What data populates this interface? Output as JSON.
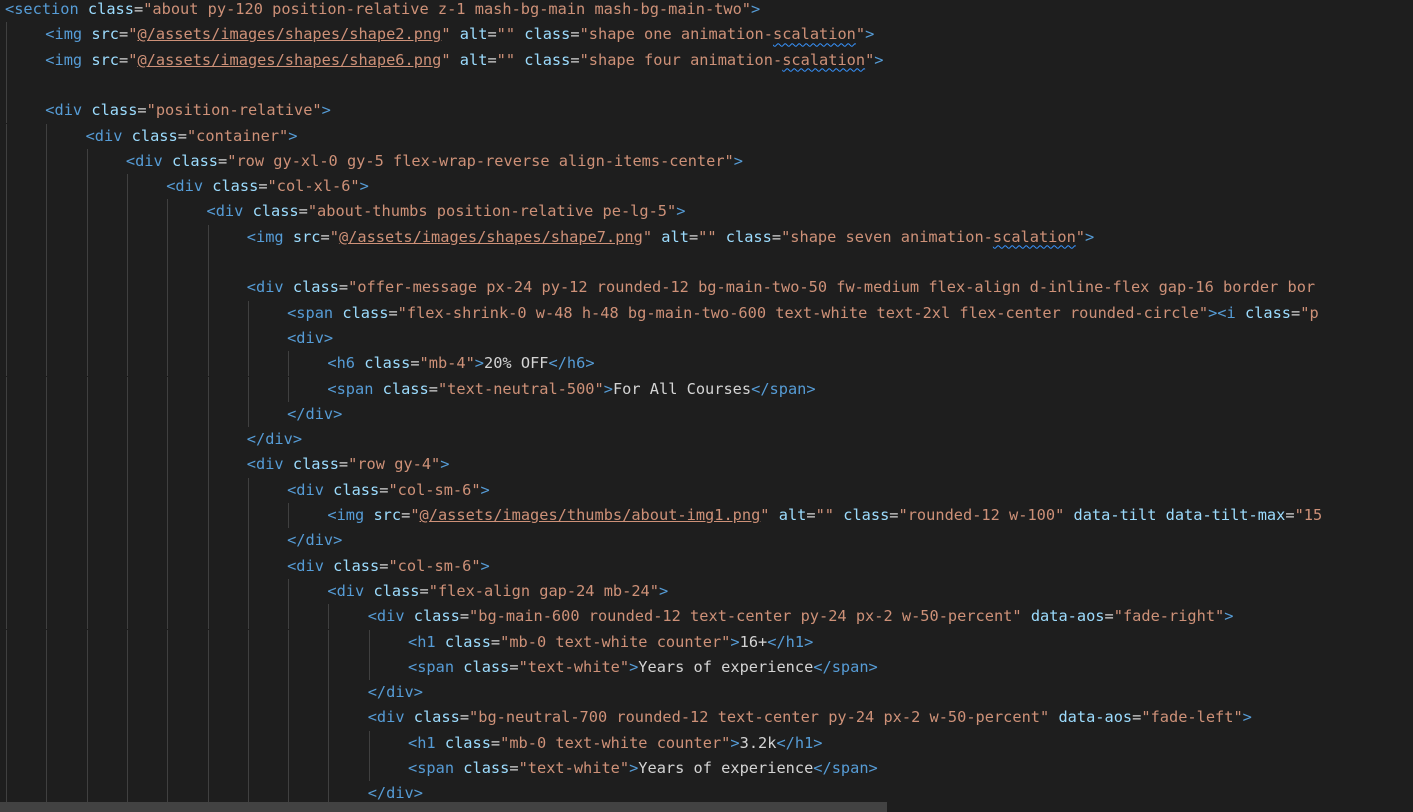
{
  "editor": {
    "lines": [
      {
        "indent": 0,
        "tokens": [
          [
            "tag",
            "<section"
          ],
          [
            "txt",
            " "
          ],
          [
            "attr",
            "class"
          ],
          [
            "txt",
            "="
          ],
          [
            "val",
            "\"about py-120 position-relative z-1 mash-bg-main mash-bg-main-two\""
          ],
          [
            "tag",
            ">"
          ]
        ]
      },
      {
        "indent": 1,
        "tokens": [
          [
            "tag",
            "<img"
          ],
          [
            "txt",
            " "
          ],
          [
            "attr",
            "src"
          ],
          [
            "txt",
            "="
          ],
          [
            "val",
            "\""
          ],
          [
            "val url",
            "@/assets/images/shapes/shape2.png"
          ],
          [
            "val",
            "\""
          ],
          [
            "txt",
            " "
          ],
          [
            "attr",
            "alt"
          ],
          [
            "txt",
            "="
          ],
          [
            "val",
            "\"\""
          ],
          [
            "txt",
            " "
          ],
          [
            "attr",
            "class"
          ],
          [
            "txt",
            "="
          ],
          [
            "val",
            "\"shape one animation-"
          ],
          [
            "val squiggle",
            "scalation"
          ],
          [
            "val",
            "\""
          ],
          [
            "tag",
            ">"
          ]
        ]
      },
      {
        "indent": 1,
        "tokens": [
          [
            "tag",
            "<img"
          ],
          [
            "txt",
            " "
          ],
          [
            "attr",
            "src"
          ],
          [
            "txt",
            "="
          ],
          [
            "val",
            "\""
          ],
          [
            "val url",
            "@/assets/images/shapes/shape6.png"
          ],
          [
            "val",
            "\""
          ],
          [
            "txt",
            " "
          ],
          [
            "attr",
            "alt"
          ],
          [
            "txt",
            "="
          ],
          [
            "val",
            "\"\""
          ],
          [
            "txt",
            " "
          ],
          [
            "attr",
            "class"
          ],
          [
            "txt",
            "="
          ],
          [
            "val",
            "\"shape four animation-"
          ],
          [
            "val squiggle",
            "scalation"
          ],
          [
            "val",
            "\""
          ],
          [
            "tag",
            ">"
          ]
        ]
      },
      {
        "indent": 0,
        "tokens": []
      },
      {
        "indent": 1,
        "tokens": [
          [
            "tag",
            "<div"
          ],
          [
            "txt",
            " "
          ],
          [
            "attr",
            "class"
          ],
          [
            "txt",
            "="
          ],
          [
            "val",
            "\"position-relative\""
          ],
          [
            "tag",
            ">"
          ]
        ]
      },
      {
        "indent": 2,
        "tokens": [
          [
            "tag",
            "<div"
          ],
          [
            "txt",
            " "
          ],
          [
            "attr",
            "class"
          ],
          [
            "txt",
            "="
          ],
          [
            "val",
            "\"container\""
          ],
          [
            "tag",
            ">"
          ]
        ]
      },
      {
        "indent": 3,
        "tokens": [
          [
            "tag",
            "<div"
          ],
          [
            "txt",
            " "
          ],
          [
            "attr",
            "class"
          ],
          [
            "txt",
            "="
          ],
          [
            "val",
            "\"row gy-xl-0 gy-5 flex-wrap-reverse align-items-center\""
          ],
          [
            "tag",
            ">"
          ]
        ]
      },
      {
        "indent": 4,
        "tokens": [
          [
            "tag",
            "<div"
          ],
          [
            "txt",
            " "
          ],
          [
            "attr",
            "class"
          ],
          [
            "txt",
            "="
          ],
          [
            "val",
            "\"col-xl-6\""
          ],
          [
            "tag",
            ">"
          ]
        ]
      },
      {
        "indent": 5,
        "tokens": [
          [
            "tag",
            "<div"
          ],
          [
            "txt",
            " "
          ],
          [
            "attr",
            "class"
          ],
          [
            "txt",
            "="
          ],
          [
            "val",
            "\"about-thumbs position-relative pe-lg-5\""
          ],
          [
            "tag",
            ">"
          ]
        ]
      },
      {
        "indent": 6,
        "tokens": [
          [
            "tag",
            "<img"
          ],
          [
            "txt",
            " "
          ],
          [
            "attr",
            "src"
          ],
          [
            "txt",
            "="
          ],
          [
            "val",
            "\""
          ],
          [
            "val url",
            "@/assets/images/shapes/shape7.png"
          ],
          [
            "val",
            "\""
          ],
          [
            "txt",
            " "
          ],
          [
            "attr",
            "alt"
          ],
          [
            "txt",
            "="
          ],
          [
            "val",
            "\"\""
          ],
          [
            "txt",
            " "
          ],
          [
            "attr",
            "class"
          ],
          [
            "txt",
            "="
          ],
          [
            "val",
            "\"shape seven animation-"
          ],
          [
            "val squiggle",
            "scalation"
          ],
          [
            "val",
            "\""
          ],
          [
            "tag",
            ">"
          ]
        ]
      },
      {
        "indent": 0,
        "tokens": []
      },
      {
        "indent": 6,
        "tokens": [
          [
            "tag",
            "<div"
          ],
          [
            "txt",
            " "
          ],
          [
            "attr",
            "class"
          ],
          [
            "txt",
            "="
          ],
          [
            "val",
            "\"offer-message px-24 py-12 rounded-12 bg-main-two-50 fw-medium flex-align d-inline-flex gap-16 border bor"
          ]
        ]
      },
      {
        "indent": 7,
        "tokens": [
          [
            "tag",
            "<span"
          ],
          [
            "txt",
            " "
          ],
          [
            "attr",
            "class"
          ],
          [
            "txt",
            "="
          ],
          [
            "val",
            "\"flex-shrink-0 w-48 h-48 bg-main-two-600 text-white text-2xl flex-center rounded-circle\""
          ],
          [
            "tag",
            "><i"
          ],
          [
            "txt",
            " "
          ],
          [
            "attr",
            "class"
          ],
          [
            "txt",
            "="
          ],
          [
            "val",
            "\"p"
          ]
        ]
      },
      {
        "indent": 7,
        "tokens": [
          [
            "tag",
            "<div>"
          ]
        ]
      },
      {
        "indent": 8,
        "tokens": [
          [
            "tag",
            "<h6"
          ],
          [
            "txt",
            " "
          ],
          [
            "attr",
            "class"
          ],
          [
            "txt",
            "="
          ],
          [
            "val",
            "\"mb-4\""
          ],
          [
            "tag",
            ">"
          ],
          [
            "txt",
            "20% OFF"
          ],
          [
            "tag",
            "</h6>"
          ]
        ]
      },
      {
        "indent": 8,
        "tokens": [
          [
            "tag",
            "<span"
          ],
          [
            "txt",
            " "
          ],
          [
            "attr",
            "class"
          ],
          [
            "txt",
            "="
          ],
          [
            "val",
            "\"text-neutral-500\""
          ],
          [
            "tag",
            ">"
          ],
          [
            "txt",
            "For All Courses"
          ],
          [
            "tag",
            "</span>"
          ]
        ]
      },
      {
        "indent": 7,
        "tokens": [
          [
            "tag",
            "</div>"
          ]
        ]
      },
      {
        "indent": 6,
        "tokens": [
          [
            "tag",
            "</div>"
          ]
        ]
      },
      {
        "indent": 6,
        "tokens": [
          [
            "tag",
            "<div"
          ],
          [
            "txt",
            " "
          ],
          [
            "attr",
            "class"
          ],
          [
            "txt",
            "="
          ],
          [
            "val",
            "\"row gy-4\""
          ],
          [
            "tag",
            ">"
          ]
        ]
      },
      {
        "indent": 7,
        "tokens": [
          [
            "tag",
            "<div"
          ],
          [
            "txt",
            " "
          ],
          [
            "attr",
            "class"
          ],
          [
            "txt",
            "="
          ],
          [
            "val",
            "\"col-sm-6\""
          ],
          [
            "tag",
            ">"
          ]
        ]
      },
      {
        "indent": 8,
        "tokens": [
          [
            "tag",
            "<img"
          ],
          [
            "txt",
            " "
          ],
          [
            "attr",
            "src"
          ],
          [
            "txt",
            "="
          ],
          [
            "val",
            "\""
          ],
          [
            "val url",
            "@/assets/images/thumbs/about-img1.png"
          ],
          [
            "val",
            "\""
          ],
          [
            "txt",
            " "
          ],
          [
            "attr",
            "alt"
          ],
          [
            "txt",
            "="
          ],
          [
            "val",
            "\"\""
          ],
          [
            "txt",
            " "
          ],
          [
            "attr",
            "class"
          ],
          [
            "txt",
            "="
          ],
          [
            "val",
            "\"rounded-12 w-100\""
          ],
          [
            "txt",
            " "
          ],
          [
            "attr",
            "data-tilt"
          ],
          [
            "txt",
            " "
          ],
          [
            "attr",
            "data-tilt-max"
          ],
          [
            "txt",
            "="
          ],
          [
            "val",
            "\"15"
          ]
        ]
      },
      {
        "indent": 7,
        "tokens": [
          [
            "tag",
            "</div>"
          ]
        ]
      },
      {
        "indent": 7,
        "tokens": [
          [
            "tag",
            "<div"
          ],
          [
            "txt",
            " "
          ],
          [
            "attr",
            "class"
          ],
          [
            "txt",
            "="
          ],
          [
            "val",
            "\"col-sm-6\""
          ],
          [
            "tag",
            ">"
          ]
        ]
      },
      {
        "indent": 8,
        "tokens": [
          [
            "tag",
            "<div"
          ],
          [
            "txt",
            " "
          ],
          [
            "attr",
            "class"
          ],
          [
            "txt",
            "="
          ],
          [
            "val",
            "\"flex-align gap-24 mb-24\""
          ],
          [
            "tag",
            ">"
          ]
        ]
      },
      {
        "indent": 9,
        "tokens": [
          [
            "tag",
            "<div"
          ],
          [
            "txt",
            " "
          ],
          [
            "attr",
            "class"
          ],
          [
            "txt",
            "="
          ],
          [
            "val",
            "\"bg-main-600 rounded-12 text-center py-24 px-2 w-50-percent\""
          ],
          [
            "txt",
            " "
          ],
          [
            "attr",
            "data-aos"
          ],
          [
            "txt",
            "="
          ],
          [
            "val",
            "\"fade-right\""
          ],
          [
            "tag",
            ">"
          ]
        ]
      },
      {
        "indent": 10,
        "tokens": [
          [
            "tag",
            "<h1"
          ],
          [
            "txt",
            " "
          ],
          [
            "attr",
            "class"
          ],
          [
            "txt",
            "="
          ],
          [
            "val",
            "\"mb-0 text-white counter\""
          ],
          [
            "tag",
            ">"
          ],
          [
            "txt",
            "16+"
          ],
          [
            "tag",
            "</h1>"
          ]
        ]
      },
      {
        "indent": 10,
        "tokens": [
          [
            "tag",
            "<span"
          ],
          [
            "txt",
            " "
          ],
          [
            "attr",
            "class"
          ],
          [
            "txt",
            "="
          ],
          [
            "val",
            "\"text-white\""
          ],
          [
            "tag",
            ">"
          ],
          [
            "txt",
            "Years of experience"
          ],
          [
            "tag",
            "</span>"
          ]
        ]
      },
      {
        "indent": 9,
        "tokens": [
          [
            "tag",
            "</div>"
          ]
        ]
      },
      {
        "indent": 9,
        "tokens": [
          [
            "tag",
            "<div"
          ],
          [
            "txt",
            " "
          ],
          [
            "attr",
            "class"
          ],
          [
            "txt",
            "="
          ],
          [
            "val",
            "\"bg-neutral-700 rounded-12 text-center py-24 px-2 w-50-percent\""
          ],
          [
            "txt",
            " "
          ],
          [
            "attr",
            "data-aos"
          ],
          [
            "txt",
            "="
          ],
          [
            "val",
            "\"fade-left\""
          ],
          [
            "tag",
            ">"
          ]
        ]
      },
      {
        "indent": 10,
        "tokens": [
          [
            "tag",
            "<h1"
          ],
          [
            "txt",
            " "
          ],
          [
            "attr",
            "class"
          ],
          [
            "txt",
            "="
          ],
          [
            "val",
            "\"mb-0 text-white counter\""
          ],
          [
            "tag",
            ">"
          ],
          [
            "txt",
            "3.2k"
          ],
          [
            "tag",
            "</h1>"
          ]
        ]
      },
      {
        "indent": 10,
        "tokens": [
          [
            "tag",
            "<span"
          ],
          [
            "txt",
            " "
          ],
          [
            "attr",
            "class"
          ],
          [
            "txt",
            "="
          ],
          [
            "val",
            "\"text-white\""
          ],
          [
            "tag",
            ">"
          ],
          [
            "txt",
            "Years of experience"
          ],
          [
            "tag",
            "</span>"
          ]
        ]
      },
      {
        "indent": 9,
        "tokens": [
          [
            "tag",
            "</div>"
          ]
        ]
      }
    ]
  },
  "colors": {
    "background": "#1e1e1e",
    "tag": "#569cd6",
    "attribute": "#9cdcfe",
    "string": "#ce9178",
    "text": "#d4d4d4"
  }
}
